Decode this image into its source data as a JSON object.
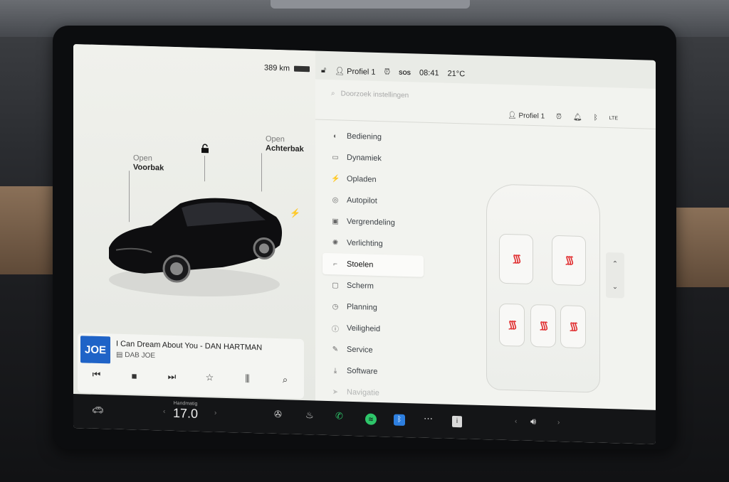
{
  "status_bar": {
    "range": "389 km",
    "profile": "Profiel 1",
    "sos": "SOS",
    "time": "08:41",
    "temperature": "21°C"
  },
  "car_panel": {
    "frunk_open": "Open",
    "frunk_label": "Voorbak",
    "trunk_open": "Open",
    "trunk_label": "Achterbak"
  },
  "media": {
    "logo": "JOE",
    "song": "I Can Dream About You - DAN HARTMAN",
    "station": "DAB JOE"
  },
  "settings": {
    "search_placeholder": "Doorzoek instellingen",
    "profile": "Profiel 1",
    "lte": "LTE",
    "menu": [
      {
        "label": "Bediening",
        "icon": "toggle-icon"
      },
      {
        "label": "Dynamiek",
        "icon": "car-icon"
      },
      {
        "label": "Opladen",
        "icon": "bolt-icon"
      },
      {
        "label": "Autopilot",
        "icon": "steering-wheel-icon"
      },
      {
        "label": "Vergrendeling",
        "icon": "lock-icon"
      },
      {
        "label": "Verlichting",
        "icon": "light-icon"
      },
      {
        "label": "Stoelen",
        "icon": "seat-icon"
      },
      {
        "label": "Scherm",
        "icon": "screen-icon"
      },
      {
        "label": "Planning",
        "icon": "clock-icon"
      },
      {
        "label": "Veiligheid",
        "icon": "info-icon"
      },
      {
        "label": "Service",
        "icon": "wrench-icon"
      },
      {
        "label": "Software",
        "icon": "download-icon"
      },
      {
        "label": "Navigatie",
        "icon": "navigation-icon"
      }
    ],
    "active_index": 6
  },
  "bottom_bar": {
    "climate_mode": "Handmatig",
    "temperature": "17.0"
  },
  "colors": {
    "seat_heat": "#e0282a",
    "phone": "#2ec66a",
    "bluetooth": "#2d7fe0"
  }
}
